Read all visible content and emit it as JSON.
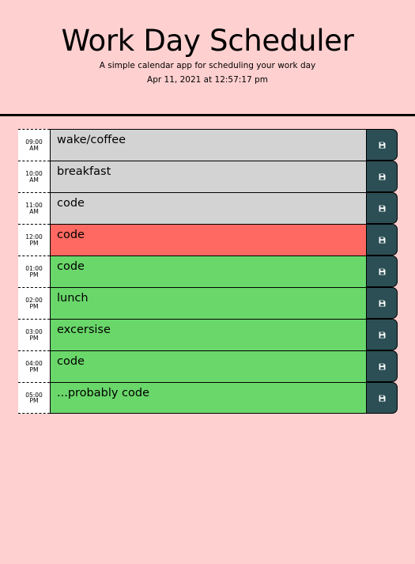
{
  "header": {
    "title": "Work Day Scheduler",
    "subtitle": "A simple calendar app for scheduling your work day",
    "current_day": "Apr 11, 2021 at 12:57:17 pm"
  },
  "colors": {
    "background": "#ffd0d0",
    "past": "#d3d3d3",
    "present": "#ff6961",
    "future": "#6ad76a",
    "save_button": "#2b4f55"
  },
  "save_icon": "floppy-disk-icon",
  "time_blocks": [
    {
      "time": "09:00",
      "period": "AM",
      "text": "wake/coffee",
      "status": "past"
    },
    {
      "time": "10:00",
      "period": "AM",
      "text": "breakfast",
      "status": "past"
    },
    {
      "time": "11:00",
      "period": "AM",
      "text": "code",
      "status": "past"
    },
    {
      "time": "12:00",
      "period": "PM",
      "text": "code",
      "status": "present"
    },
    {
      "time": "01:00",
      "period": "PM",
      "text": "code",
      "status": "future"
    },
    {
      "time": "02:00",
      "period": "PM",
      "text": "lunch",
      "status": "future"
    },
    {
      "time": "03:00",
      "period": "PM",
      "text": "excersise",
      "status": "future"
    },
    {
      "time": "04:00",
      "period": "PM",
      "text": "code",
      "status": "future"
    },
    {
      "time": "05:00",
      "period": "PM",
      "text": "...probably code",
      "status": "future"
    }
  ]
}
